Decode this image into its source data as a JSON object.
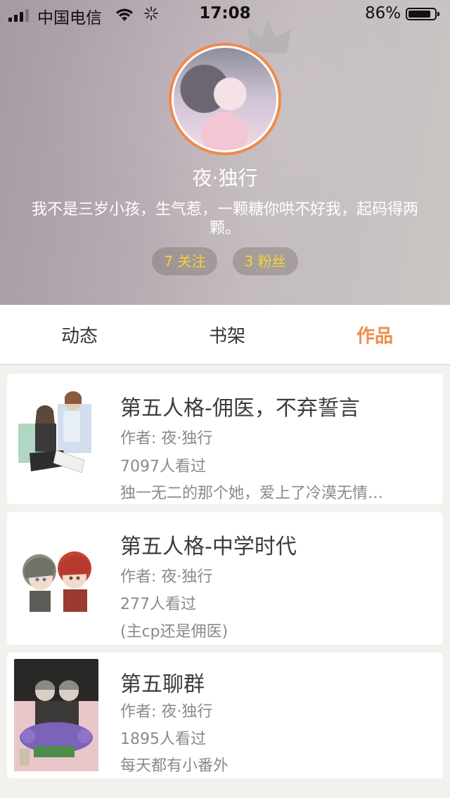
{
  "status_bar": {
    "carrier": "中国电信",
    "time": "17:08",
    "battery": "86%",
    "battery_level": 0.86
  },
  "profile": {
    "username": "夜·独行",
    "bio": "我不是三岁小孩，生气惹，一颗糖你哄不好我，起码得两颗。",
    "following": "7 关注",
    "followers": "3 粉丝"
  },
  "tabs": [
    {
      "label": "动态",
      "active": false
    },
    {
      "label": "书架",
      "active": false
    },
    {
      "label": "作品",
      "active": true
    }
  ],
  "works": [
    {
      "title": "第五人格-佣医，不弃誓言",
      "author": "作者: 夜·独行",
      "views": "7097人看过",
      "description": "独一无二的那个她，爱上了冷漠无情…"
    },
    {
      "title": "第五人格-中学时代",
      "author": "作者: 夜·独行",
      "views": "277人看过",
      "description": "(主cp还是佣医)"
    },
    {
      "title": "第五聊群",
      "author": "作者: 夜·独行",
      "views": "1895人看过",
      "description": "每天都有小番外"
    }
  ],
  "colors": {
    "accent": "#f08a4b",
    "pill_text": "#f5d23a"
  },
  "icons": [
    "signal-icon",
    "wifi-icon",
    "loading-icon",
    "battery-icon",
    "crown-icon"
  ]
}
